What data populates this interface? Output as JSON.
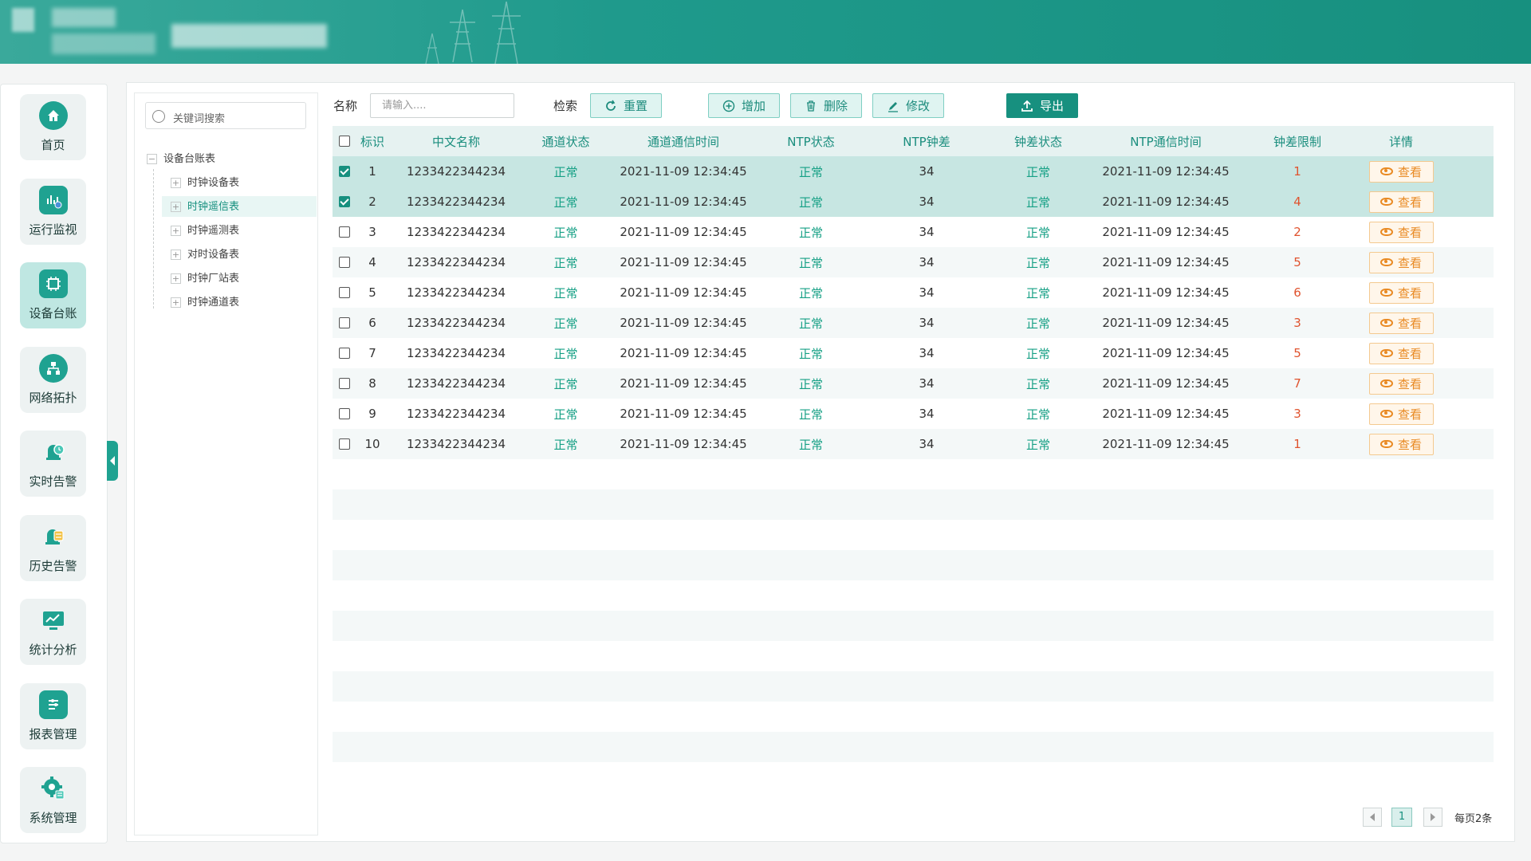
{
  "colors": {
    "accent": "#17907f",
    "accent_light": "#dff4f1",
    "status_ok": "#16a085",
    "limit_red": "#e0532e",
    "view_orange": "#e98a23"
  },
  "nav": [
    {
      "label": "首页",
      "icon": "home-icon"
    },
    {
      "label": "运行监视",
      "icon": "monitor-icon"
    },
    {
      "label": "设备台账",
      "icon": "device-ledger-icon",
      "active": true
    },
    {
      "label": "网络拓扑",
      "icon": "network-topology-icon"
    },
    {
      "label": "实时告警",
      "icon": "realtime-alarm-icon"
    },
    {
      "label": "历史告警",
      "icon": "history-alarm-icon"
    },
    {
      "label": "统计分析",
      "icon": "statistics-icon"
    },
    {
      "label": "报表管理",
      "icon": "report-icon"
    },
    {
      "label": "系统管理",
      "icon": "settings-icon"
    }
  ],
  "tree": {
    "search_placeholder": "关键词搜索",
    "root": "设备台账表",
    "children": [
      "时钟设备表",
      "时钟遥信表",
      "时钟遥测表",
      "对时设备表",
      "时钟厂站表",
      "时钟通道表"
    ],
    "selected_index": 1
  },
  "toolbar": {
    "name_label": "名称",
    "name_placeholder": "请输入....",
    "search_label": "检索",
    "reset": "重置",
    "add": "增加",
    "delete": "删除",
    "edit": "修改",
    "export": "导出"
  },
  "table": {
    "headers": [
      "标识",
      "中文名称",
      "通道状态",
      "通道通信时间",
      "NTP状态",
      "NTP钟差",
      "钟差状态",
      "NTP通信时间",
      "钟差限制",
      "详情"
    ],
    "view_label": "查看",
    "rows": [
      {
        "id": "1",
        "name": "1233422344234",
        "ch_status": "正常",
        "ch_time": "2021-11-09 12:34:45",
        "ntp_status": "正常",
        "ntp_diff": "34",
        "diff_status": "正常",
        "ntp_time": "2021-11-09 12:34:45",
        "limit": "1",
        "checked": true
      },
      {
        "id": "2",
        "name": "1233422344234",
        "ch_status": "正常",
        "ch_time": "2021-11-09 12:34:45",
        "ntp_status": "正常",
        "ntp_diff": "34",
        "diff_status": "正常",
        "ntp_time": "2021-11-09 12:34:45",
        "limit": "4",
        "checked": true
      },
      {
        "id": "3",
        "name": "1233422344234",
        "ch_status": "正常",
        "ch_time": "2021-11-09 12:34:45",
        "ntp_status": "正常",
        "ntp_diff": "34",
        "diff_status": "正常",
        "ntp_time": "2021-11-09 12:34:45",
        "limit": "2",
        "checked": false
      },
      {
        "id": "4",
        "name": "1233422344234",
        "ch_status": "正常",
        "ch_time": "2021-11-09 12:34:45",
        "ntp_status": "正常",
        "ntp_diff": "34",
        "diff_status": "正常",
        "ntp_time": "2021-11-09 12:34:45",
        "limit": "5",
        "checked": false
      },
      {
        "id": "5",
        "name": "1233422344234",
        "ch_status": "正常",
        "ch_time": "2021-11-09 12:34:45",
        "ntp_status": "正常",
        "ntp_diff": "34",
        "diff_status": "正常",
        "ntp_time": "2021-11-09 12:34:45",
        "limit": "6",
        "checked": false
      },
      {
        "id": "6",
        "name": "1233422344234",
        "ch_status": "正常",
        "ch_time": "2021-11-09 12:34:45",
        "ntp_status": "正常",
        "ntp_diff": "34",
        "diff_status": "正常",
        "ntp_time": "2021-11-09 12:34:45",
        "limit": "3",
        "checked": false
      },
      {
        "id": "7",
        "name": "1233422344234",
        "ch_status": "正常",
        "ch_time": "2021-11-09 12:34:45",
        "ntp_status": "正常",
        "ntp_diff": "34",
        "diff_status": "正常",
        "ntp_time": "2021-11-09 12:34:45",
        "limit": "5",
        "checked": false
      },
      {
        "id": "8",
        "name": "1233422344234",
        "ch_status": "正常",
        "ch_time": "2021-11-09 12:34:45",
        "ntp_status": "正常",
        "ntp_diff": "34",
        "diff_status": "正常",
        "ntp_time": "2021-11-09 12:34:45",
        "limit": "7",
        "checked": false
      },
      {
        "id": "9",
        "name": "1233422344234",
        "ch_status": "正常",
        "ch_time": "2021-11-09 12:34:45",
        "ntp_status": "正常",
        "ntp_diff": "34",
        "diff_status": "正常",
        "ntp_time": "2021-11-09 12:34:45",
        "limit": "3",
        "checked": false
      },
      {
        "id": "10",
        "name": "1233422344234",
        "ch_status": "正常",
        "ch_time": "2021-11-09 12:34:45",
        "ntp_status": "正常",
        "ntp_diff": "34",
        "diff_status": "正常",
        "ntp_time": "2021-11-09 12:34:45",
        "limit": "1",
        "checked": false
      }
    ]
  },
  "pagination": {
    "current_page": "1",
    "per_page_text": "每页2条"
  }
}
